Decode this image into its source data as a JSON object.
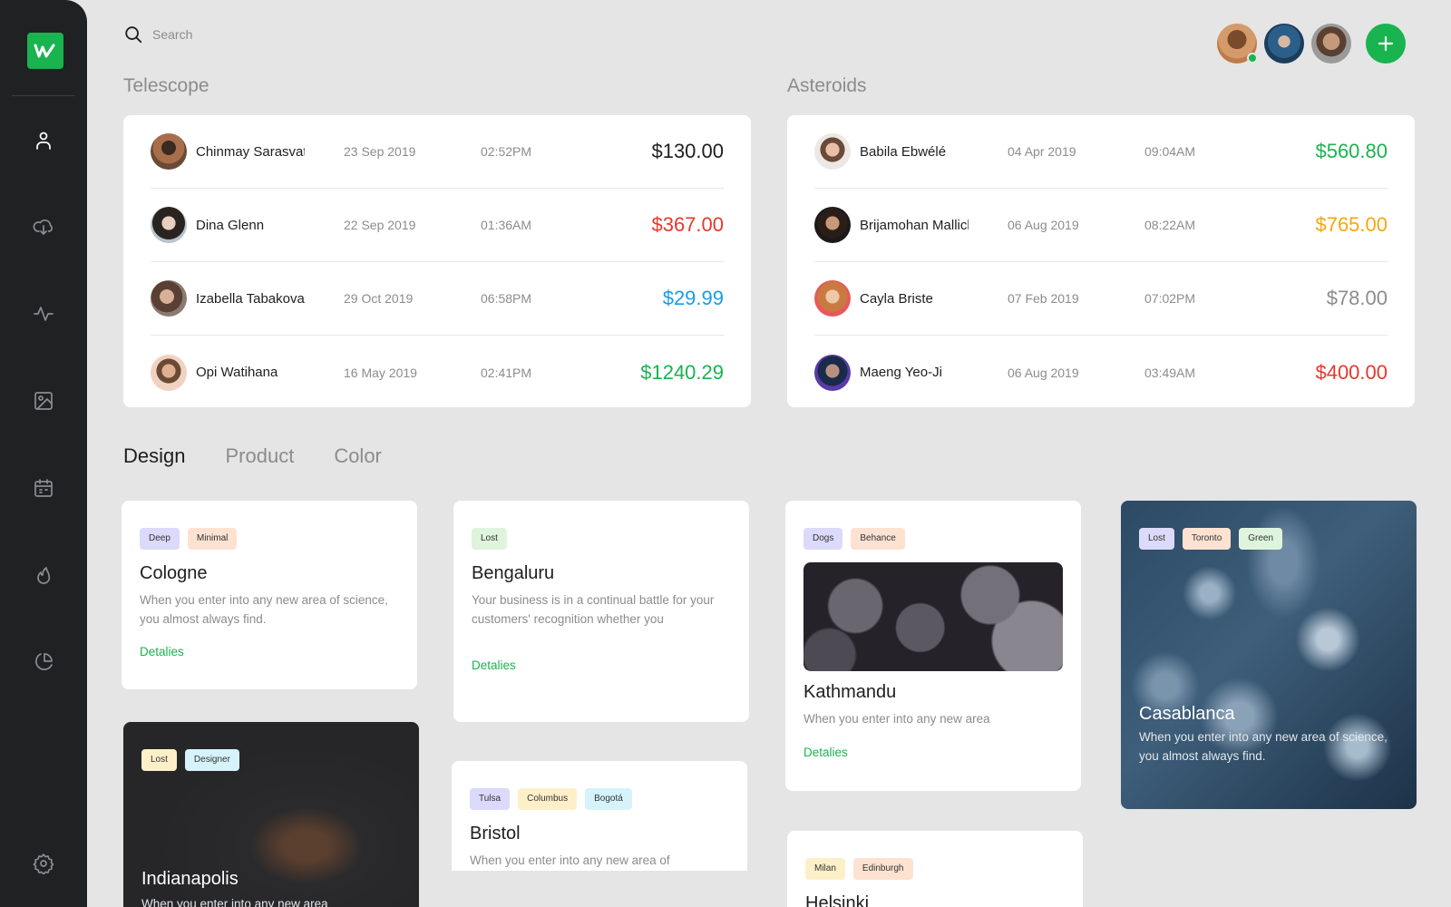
{
  "search": {
    "placeholder": "Search",
    "icon": "search-icon"
  },
  "sidebar": {
    "items": [
      {
        "name": "user",
        "icon": "user-icon",
        "active": true
      },
      {
        "name": "cloud-download",
        "icon": "cloud-download-icon",
        "active": false
      },
      {
        "name": "activity",
        "icon": "activity-icon",
        "active": false
      },
      {
        "name": "image",
        "icon": "image-icon",
        "active": false
      },
      {
        "name": "calendar",
        "icon": "calendar-icon",
        "active": false
      },
      {
        "name": "flame",
        "icon": "flame-icon",
        "active": false
      },
      {
        "name": "pie-chart",
        "icon": "pie-chart-icon",
        "active": false
      },
      {
        "name": "settings",
        "icon": "gear-icon",
        "active": false
      }
    ]
  },
  "sections": {
    "telescope": {
      "title": "Telescope",
      "rows": [
        {
          "name": "Chinmay Sarasvati",
          "date": "23 Sep 2019",
          "time": "02:52PM",
          "amount": "$130.00",
          "color": "#1e1e1e"
        },
        {
          "name": "Dina Glenn",
          "date": "22 Sep 2019",
          "time": "01:36AM",
          "amount": "$367.00",
          "color": "#e8372c"
        },
        {
          "name": "Izabella Tabakova",
          "date": "29 Oct 2019",
          "time": "06:58PM",
          "amount": "$29.99",
          "color": "#1a9be8"
        },
        {
          "name": "Opi Watihana",
          "date": "16 May 2019",
          "time": "02:41PM",
          "amount": "$1240.29",
          "color": "#19b34f"
        }
      ]
    },
    "asteroids": {
      "title": "Asteroids",
      "rows": [
        {
          "name": "Babila Ebwélé",
          "date": "04 Apr 2019",
          "time": "09:04AM",
          "amount": "$560.80",
          "color": "#19b34f"
        },
        {
          "name": "Brijamohan Mallick",
          "date": "06 Aug 2019",
          "time": "08:22AM",
          "amount": "$765.00",
          "color": "#f5a70f"
        },
        {
          "name": "Cayla Briste",
          "date": "07 Feb 2019",
          "time": "07:02PM",
          "amount": "$78.00",
          "color": "#8c8c8c"
        },
        {
          "name": "Maeng Yeo-Ji",
          "date": "06 Aug 2019",
          "time": "03:49AM",
          "amount": "$400.00",
          "color": "#e8372c"
        }
      ]
    }
  },
  "tabs": [
    {
      "label": "Design",
      "active": true
    },
    {
      "label": "Product",
      "active": false
    },
    {
      "label": "Color",
      "active": false
    }
  ],
  "cards": {
    "cologne": {
      "tags": [
        {
          "label": "Deep",
          "color": "#dcdafa"
        },
        {
          "label": "Minimal",
          "color": "#fde2d2"
        }
      ],
      "title": "Cologne",
      "text": "When you enter into any new area of science, you almost always find.",
      "link": "Detalies"
    },
    "bengaluru": {
      "tags": [
        {
          "label": "Lost",
          "color": "#dff4dd"
        }
      ],
      "title": "Bengaluru",
      "text": "Your business is in a continual battle for your customers' recognition whether you",
      "link": "Detalies"
    },
    "kathmandu": {
      "tags": [
        {
          "label": "Dogs",
          "color": "#dcdafa"
        },
        {
          "label": "Behance",
          "color": "#fde2d2"
        }
      ],
      "title": "Kathmandu",
      "text": "When you enter into any new area",
      "link": "Detalies"
    },
    "casablanca": {
      "tags": [
        {
          "label": "Lost",
          "color": "#dcdafa"
        },
        {
          "label": "Toronto",
          "color": "#fde2d2"
        },
        {
          "label": "Green",
          "color": "#dff4dd"
        }
      ],
      "title": "Casablanca",
      "text": "When you enter into any new area of science, you almost always find."
    },
    "indianapolis": {
      "tags": [
        {
          "label": "Lost",
          "color": "#fdf0c9"
        },
        {
          "label": "Designer",
          "color": "#d6f3fb"
        }
      ],
      "title": "Indianapolis",
      "text": "When you enter into any new area"
    },
    "bristol": {
      "tags": [
        {
          "label": "Tulsa",
          "color": "#dcdafa"
        },
        {
          "label": "Columbus",
          "color": "#fdf0c9"
        },
        {
          "label": "Bogotá",
          "color": "#d6f3fb"
        }
      ],
      "title": "Bristol",
      "text": "When you enter into any new area of"
    },
    "helsinki": {
      "tags": [
        {
          "label": "Milan",
          "color": "#fdf0c9"
        },
        {
          "label": "Edinburgh",
          "color": "#fde2d2"
        }
      ],
      "title": "Helsinki"
    }
  },
  "colors": {
    "accent": "#19b34f",
    "sidebar": "#1f2123",
    "background": "#e5e5e5"
  }
}
